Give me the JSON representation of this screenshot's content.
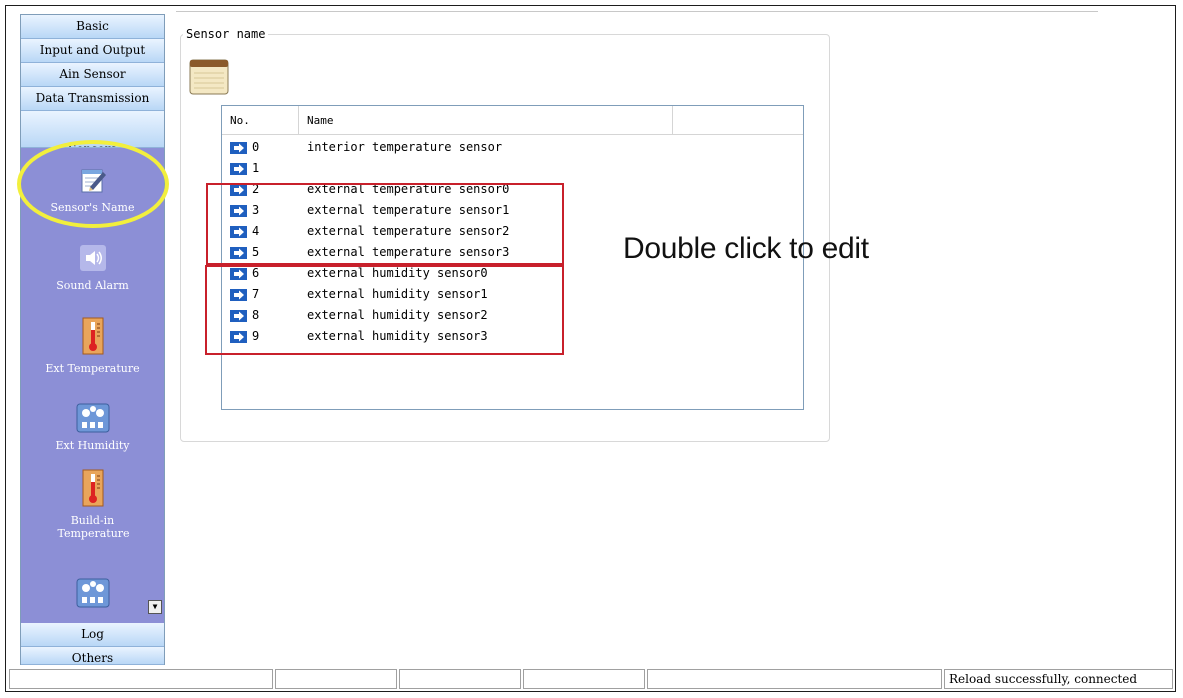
{
  "nav": {
    "categories_top": [
      "Basic",
      "Input and Output",
      "Ain Sensor",
      "Data Transmission",
      "Sensors"
    ],
    "items": [
      {
        "label": "Sensor's Name",
        "icon": "notepad-pen-icon"
      },
      {
        "label": "Sound Alarm",
        "icon": "speaker-icon"
      },
      {
        "label": "Ext Temperature",
        "icon": "thermometer-icon"
      },
      {
        "label": "Ext Humidity",
        "icon": "humidity-meter-icon"
      },
      {
        "label": "Build-in Temperature",
        "icon": "thermometer-icon"
      },
      {
        "label": "",
        "icon": "humidity-meter-icon"
      }
    ],
    "categories_bottom": [
      "Log",
      "Others"
    ]
  },
  "main": {
    "group_title": "Sensor name",
    "list": {
      "columns": [
        "No.",
        "Name"
      ],
      "rows": [
        {
          "no": "0",
          "name": "interior temperature sensor"
        },
        {
          "no": "1",
          "name": ""
        },
        {
          "no": "2",
          "name": "external temperature sensor0"
        },
        {
          "no": "3",
          "name": "external temperature sensor1"
        },
        {
          "no": "4",
          "name": "external temperature sensor2"
        },
        {
          "no": "5",
          "name": "external temperature sensor3"
        },
        {
          "no": "6",
          "name": "external humidity sensor0"
        },
        {
          "no": "7",
          "name": "external humidity sensor1"
        },
        {
          "no": "8",
          "name": "external humidity sensor2"
        },
        {
          "no": "9",
          "name": "external humidity sensor3"
        }
      ]
    },
    "callout": "Double click to edit"
  },
  "statusbar": {
    "message": "Reload successfully, connected"
  },
  "colors": {
    "nav_panel": "#8c8fd6",
    "highlight_ring": "#f2ef3d",
    "annotation_box": "#c8202b",
    "row_arrow": "#1f5fbf"
  }
}
